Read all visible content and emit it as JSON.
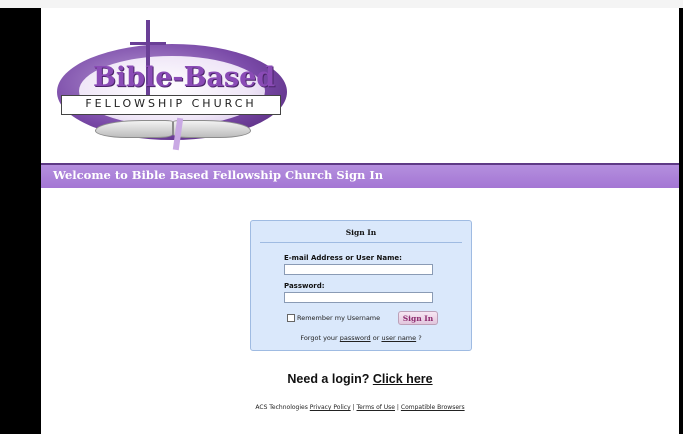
{
  "logo": {
    "wordmark": "Bible-Based",
    "subtitle": "FELLOWSHIP CHURCH"
  },
  "banner": {
    "title": "Welcome to Bible Based Fellowship Church Sign In"
  },
  "signin": {
    "heading": "Sign In",
    "email_label": "E-mail Address or User Name:",
    "email_value": "",
    "password_label": "Password:",
    "password_value": "",
    "remember_label": "Remember my Username",
    "remember_checked": false,
    "button_label": "Sign In",
    "forgot_prefix": "Forgot your",
    "forgot_password_link": "password",
    "forgot_or": "or",
    "forgot_username_link": "user name",
    "forgot_suffix": "?"
  },
  "need_login": {
    "text": "Need a login?",
    "link": "Click here"
  },
  "footer": {
    "vendor": "ACS Technologies",
    "privacy_link": "Privacy Policy",
    "terms_link": "Terms of Use",
    "browsers_link": "Compatible Browsers",
    "separator": "|"
  },
  "colors": {
    "banner": "#a476d4",
    "panel_bg": "#dae8fb",
    "panel_border": "#9fbbe2",
    "signin_button_text": "#8c2a6e"
  }
}
